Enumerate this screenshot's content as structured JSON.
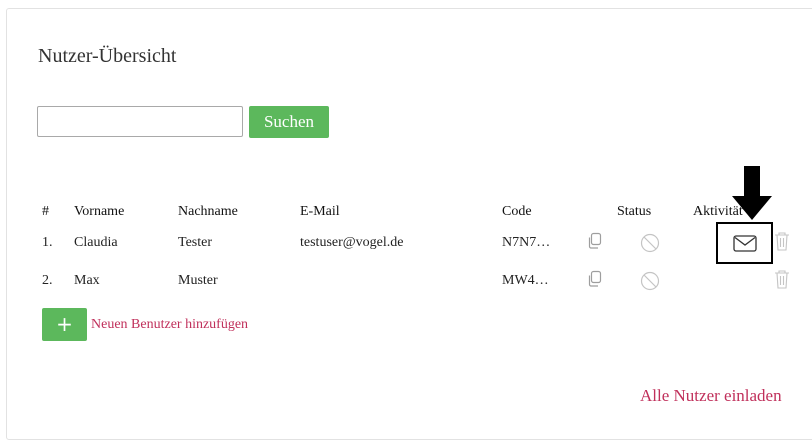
{
  "page": {
    "title": "Nutzer-Übersicht"
  },
  "search": {
    "value": "",
    "placeholder": "",
    "button_label": "Suchen"
  },
  "table": {
    "headers": {
      "index": "#",
      "firstname": "Vorname",
      "lastname": "Nachname",
      "email": "E-Mail",
      "code": "Code",
      "status": "Status",
      "activity": "Aktivität"
    },
    "rows": [
      {
        "index": "1.",
        "firstname": "Claudia",
        "lastname": "Tester",
        "email": "testuser@vogel.de",
        "code": "N7N7…"
      },
      {
        "index": "2.",
        "firstname": "Max",
        "lastname": "Muster",
        "email": "",
        "code": "MW4…"
      }
    ]
  },
  "add_user": {
    "button_label": "+",
    "link_label": "Neuen Benutzer hinzufügen"
  },
  "invite_all": {
    "label": "Alle Nutzer einladen"
  },
  "colors": {
    "green": "#5cb85c",
    "link": "#c0305b",
    "icon_gray": "#9e9e9e"
  },
  "icons": [
    "copy-icon",
    "status-blocked-icon",
    "mail-icon",
    "trash-icon",
    "arrow-down-icon"
  ]
}
